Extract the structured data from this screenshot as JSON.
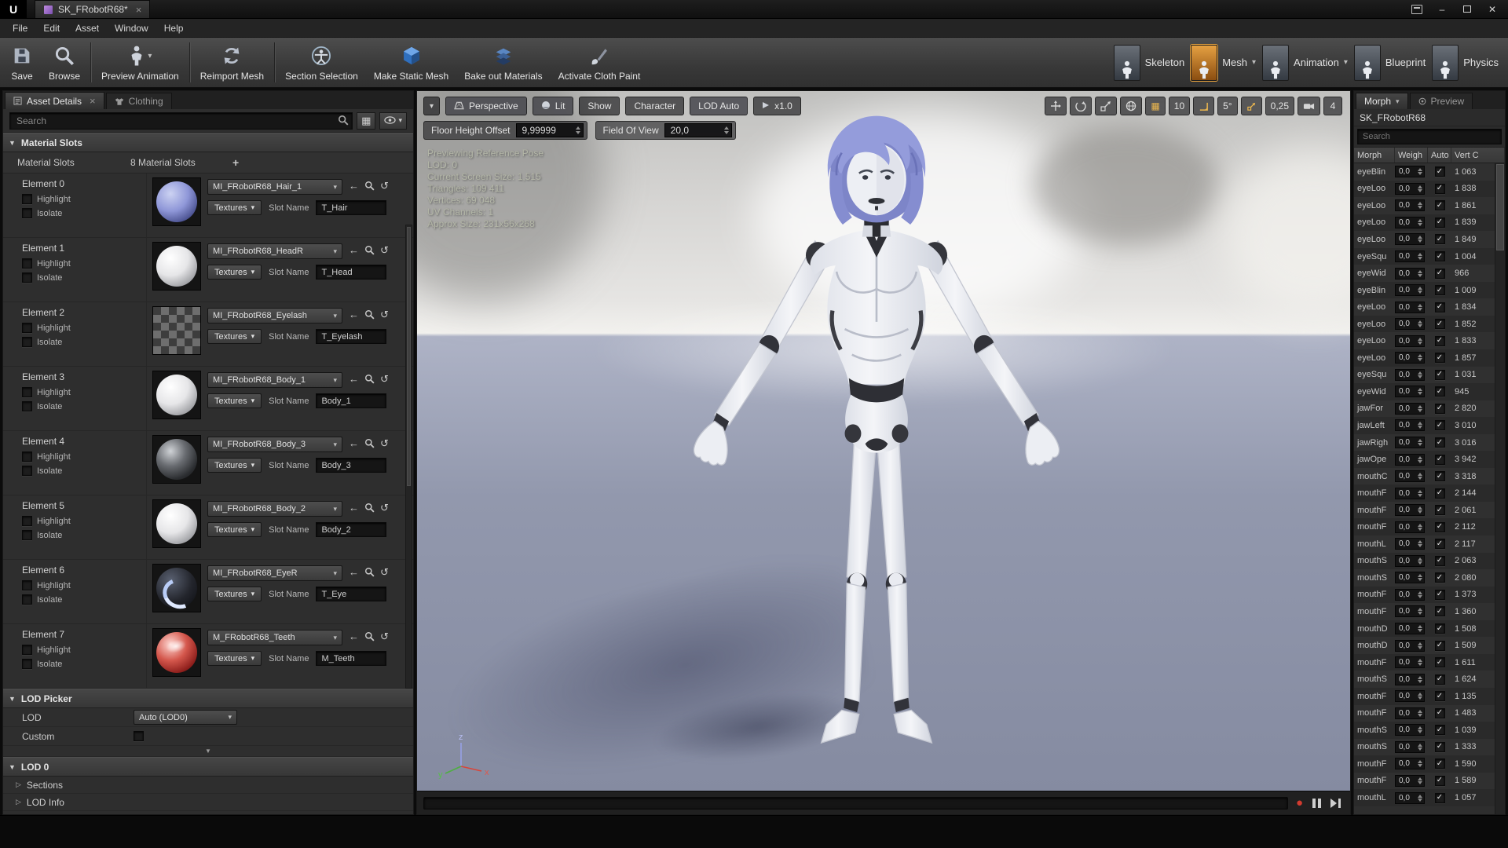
{
  "icons": {
    "chevron_down": "▾",
    "close": "×",
    "close_window": "✕",
    "minimize": "–",
    "plus": "+",
    "arrow_left": "←",
    "reset": "↺",
    "check": "✓",
    "expander_right": "▷",
    "expander_down": "▼",
    "record": "●",
    "grid_view": "▦"
  },
  "titlebar": {
    "logo": "U",
    "tab_title": "SK_FRobotR68*"
  },
  "menubar": {
    "items": [
      "File",
      "Edit",
      "Asset",
      "Window",
      "Help"
    ]
  },
  "toolbar": {
    "buttons": [
      {
        "label": "Save",
        "icon": "save-icon"
      },
      {
        "label": "Browse",
        "icon": "browse-icon"
      },
      {
        "label": "Preview Animation",
        "icon": "preview-animation-icon"
      },
      {
        "label": "Reimport Mesh",
        "icon": "reimport-mesh-icon"
      },
      {
        "label": "Section Selection",
        "icon": "section-selection-icon"
      },
      {
        "label": "Make Static Mesh",
        "icon": "make-static-mesh-icon"
      },
      {
        "label": "Bake out Materials",
        "icon": "bake-out-materials-icon"
      },
      {
        "label": "Activate Cloth Paint",
        "icon": "activate-cloth-paint-icon"
      }
    ],
    "modes": [
      {
        "label": "Skeleton"
      },
      {
        "label": "Mesh"
      },
      {
        "label": "Animation"
      },
      {
        "label": "Blueprint"
      },
      {
        "label": "Physics"
      }
    ]
  },
  "left_panel": {
    "tabs": [
      {
        "label": "Asset Details"
      },
      {
        "label": "Clothing"
      }
    ],
    "search_placeholder": "Search",
    "material_slots_header": "Material Slots",
    "material_slots_label": "Material Slots",
    "material_slots_count": "8 Material Slots",
    "highlight_label": "Highlight",
    "isolate_label": "Isolate",
    "textures_label": "Textures",
    "slot_name_label": "Slot Name",
    "elements": [
      {
        "name": "Element 0",
        "material": "MI_FRobotR68_Hair_1",
        "slot_name": "T_Hair",
        "thumb": "hair"
      },
      {
        "name": "Element 1",
        "material": "MI_FRobotR68_HeadR",
        "slot_name": "T_Head",
        "thumb": "white"
      },
      {
        "name": "Element 2",
        "material": "MI_FRobotR68_Eyelash",
        "slot_name": "T_Eyelash",
        "thumb": "checker"
      },
      {
        "name": "Element 3",
        "material": "MI_FRobotR68_Body_1",
        "slot_name": "Body_1",
        "thumb": "white"
      },
      {
        "name": "Element 4",
        "material": "MI_FRobotR68_Body_3",
        "slot_name": "Body_3",
        "thumb": "dark"
      },
      {
        "name": "Element 5",
        "material": "MI_FRobotR68_Body_2",
        "slot_name": "Body_2",
        "thumb": "white"
      },
      {
        "name": "Element 6",
        "material": "MI_FRobotR68_EyeR",
        "slot_name": "T_Eye",
        "thumb": "eye"
      },
      {
        "name": "Element 7",
        "material": "M_FRobotR68_Teeth",
        "slot_name": "M_Teeth",
        "thumb": "teeth"
      }
    ],
    "lod_picker": {
      "header": "LOD Picker",
      "lod_label": "LOD",
      "lod_value": "Auto (LOD0)",
      "custom_label": "Custom"
    },
    "lod0": {
      "header": "LOD 0",
      "rows": [
        "Sections",
        "LOD Info"
      ]
    }
  },
  "viewport": {
    "buttons": {
      "perspective": "Perspective",
      "lit": "Lit",
      "show": "Show",
      "character": "Character",
      "lod": "LOD Auto",
      "speed": "x1.0"
    },
    "floor_height_offset_label": "Floor Height Offset",
    "floor_height_offset_value": "9,99999",
    "fov_label": "Field Of View",
    "fov_value": "20,0",
    "info": [
      "Previewing Reference Pose",
      "LOD: 0",
      "Current Screen Size: 1,515",
      "Triangles: 109 411",
      "Vertices: 69 048",
      "UV Channels: 1",
      "Approx Size: 231x56x268"
    ],
    "snap": {
      "grid": "10",
      "angle": "5°",
      "scale": "0,25",
      "camera_speed": "4"
    },
    "axis": {
      "x": "x",
      "y": "y",
      "z": "z"
    }
  },
  "right_panel": {
    "tabs": [
      {
        "label": "Morph"
      },
      {
        "label": "Preview"
      }
    ],
    "asset_name": "SK_FRobotR68",
    "search_placeholder": "Search",
    "columns": [
      "Morph",
      "Weigh",
      "Auto",
      "Vert C"
    ],
    "rows": [
      {
        "name": "eyeBlin",
        "weight": "0,0",
        "verts": "1 063"
      },
      {
        "name": "eyeLoo",
        "weight": "0,0",
        "verts": "1 838"
      },
      {
        "name": "eyeLoo",
        "weight": "0,0",
        "verts": "1 861"
      },
      {
        "name": "eyeLoo",
        "weight": "0,0",
        "verts": "1 839"
      },
      {
        "name": "eyeLoo",
        "weight": "0,0",
        "verts": "1 849"
      },
      {
        "name": "eyeSqu",
        "weight": "0,0",
        "verts": "1 004"
      },
      {
        "name": "eyeWid",
        "weight": "0,0",
        "verts": "966"
      },
      {
        "name": "eyeBlin",
        "weight": "0,0",
        "verts": "1 009"
      },
      {
        "name": "eyeLoo",
        "weight": "0,0",
        "verts": "1 834"
      },
      {
        "name": "eyeLoo",
        "weight": "0,0",
        "verts": "1 852"
      },
      {
        "name": "eyeLoo",
        "weight": "0,0",
        "verts": "1 833"
      },
      {
        "name": "eyeLoo",
        "weight": "0,0",
        "verts": "1 857"
      },
      {
        "name": "eyeSqu",
        "weight": "0,0",
        "verts": "1 031"
      },
      {
        "name": "eyeWid",
        "weight": "0,0",
        "verts": "945"
      },
      {
        "name": "jawFor",
        "weight": "0,0",
        "verts": "2 820"
      },
      {
        "name": "jawLeft",
        "weight": "0,0",
        "verts": "3 010"
      },
      {
        "name": "jawRigh",
        "weight": "0,0",
        "verts": "3 016"
      },
      {
        "name": "jawOpe",
        "weight": "0,0",
        "verts": "3 942"
      },
      {
        "name": "mouthC",
        "weight": "0,0",
        "verts": "3 318"
      },
      {
        "name": "mouthF",
        "weight": "0,0",
        "verts": "2 144"
      },
      {
        "name": "mouthF",
        "weight": "0,0",
        "verts": "2 061"
      },
      {
        "name": "mouthF",
        "weight": "0,0",
        "verts": "2 112"
      },
      {
        "name": "mouthL",
        "weight": "0,0",
        "verts": "2 117"
      },
      {
        "name": "mouthS",
        "weight": "0,0",
        "verts": "2 063"
      },
      {
        "name": "mouthS",
        "weight": "0,0",
        "verts": "2 080"
      },
      {
        "name": "mouthF",
        "weight": "0,0",
        "verts": "1 373"
      },
      {
        "name": "mouthF",
        "weight": "0,0",
        "verts": "1 360"
      },
      {
        "name": "mouthD",
        "weight": "0,0",
        "verts": "1 508"
      },
      {
        "name": "mouthD",
        "weight": "0,0",
        "verts": "1 509"
      },
      {
        "name": "mouthF",
        "weight": "0,0",
        "verts": "1 611"
      },
      {
        "name": "mouthS",
        "weight": "0,0",
        "verts": "1 624"
      },
      {
        "name": "mouthF",
        "weight": "0,0",
        "verts": "1 135"
      },
      {
        "name": "mouthF",
        "weight": "0,0",
        "verts": "1 483"
      },
      {
        "name": "mouthS",
        "weight": "0,0",
        "verts": "1 039"
      },
      {
        "name": "mouthS",
        "weight": "0,0",
        "verts": "1 333"
      },
      {
        "name": "mouthF",
        "weight": "0,0",
        "verts": "1 590"
      },
      {
        "name": "mouthF",
        "weight": "0,0",
        "verts": "1 589"
      },
      {
        "name": "mouthL",
        "weight": "0,0",
        "verts": "1 057"
      }
    ]
  },
  "colors": {
    "accent_orange": "#d48a21",
    "viewport_floor": "#9096ab",
    "record_red": "#d23b2f"
  }
}
